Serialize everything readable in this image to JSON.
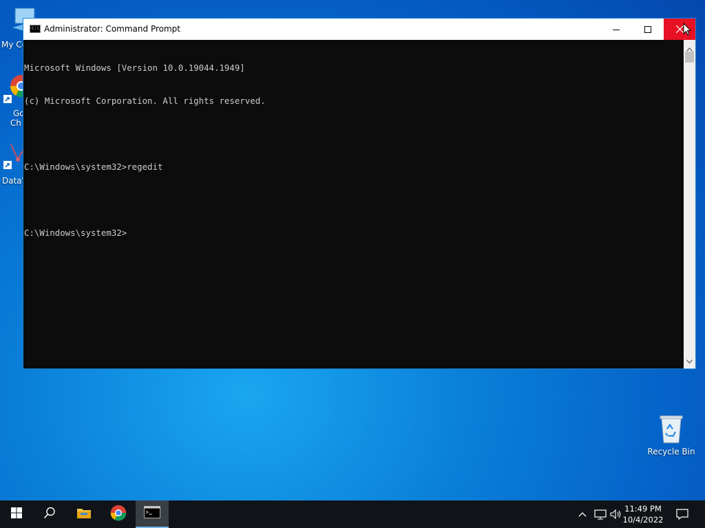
{
  "desktop": {
    "icons": [
      {
        "label": "My Co"
      },
      {
        "label": "Go",
        "label2": "Ch"
      },
      {
        "label": "DataW"
      },
      {
        "label": "Recycle Bin"
      }
    ]
  },
  "window": {
    "title": "Administrator: Command Prompt",
    "title_icon_text": "C:\\_",
    "console_lines": [
      "Microsoft Windows [Version 10.0.19044.1949]",
      "(c) Microsoft Corporation. All rights reserved.",
      "",
      "C:\\Windows\\system32>regedit",
      "",
      "C:\\Windows\\system32>"
    ]
  },
  "taskbar": {
    "clock_time": "11:49 PM",
    "clock_date": "10/4/2022"
  },
  "colors": {
    "close_red": "#e81123",
    "console_bg": "#0c0c0c",
    "console_text": "#cccccc",
    "taskbar_bg": "#101418"
  },
  "icons": [
    "windows-start-icon",
    "search-icon",
    "file-explorer-icon",
    "chrome-icon",
    "cmd-icon",
    "chevron-up-icon",
    "network-icon",
    "volume-icon",
    "notification-icon",
    "recycle-bin-icon",
    "close-icon",
    "maximize-icon",
    "minimize-icon"
  ]
}
